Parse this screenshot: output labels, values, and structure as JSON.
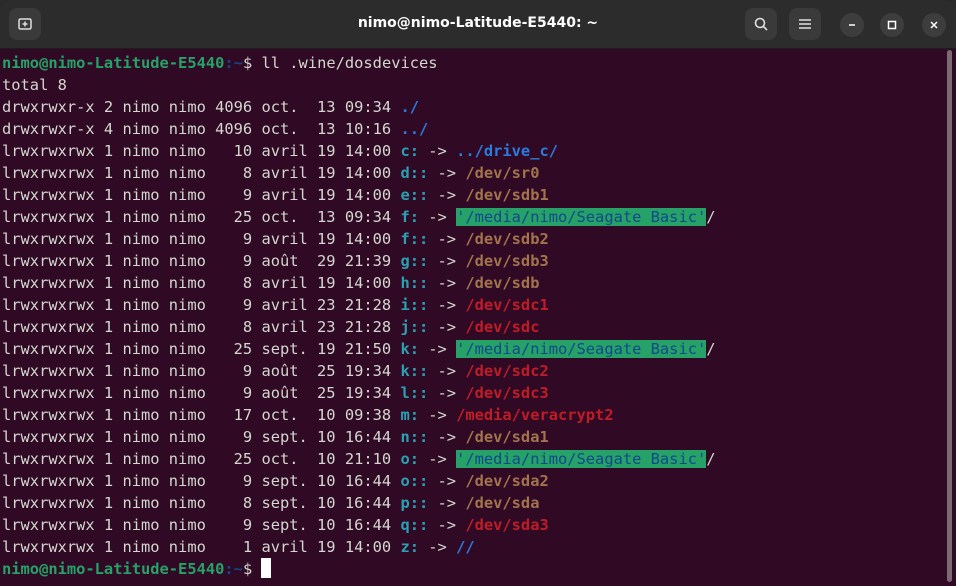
{
  "window": {
    "title": "nimo@nimo-Latitude-E5440: ~"
  },
  "titlebar": {
    "new_tab_icon": "new-tab-icon",
    "search_icon": "search-icon",
    "menu_icon": "hamburger-menu-icon"
  },
  "colors": {
    "background": "#300a24",
    "prompt_user": "#26a269",
    "prompt_path": "#12488b",
    "link": "#2aa1b3",
    "directory": "#2a7bde",
    "highlight": "#26a269"
  },
  "terminal": {
    "prompt_user": "nimo@nimo-Latitude-E5440",
    "prompt_path": ":~",
    "prompt_symbol": "$ ",
    "command": "ll .wine/dosdevices",
    "total": "total 8",
    "rows": [
      {
        "perms": "drwxrwxr-x",
        "links": "2",
        "owner": "nimo",
        "group": "nimo",
        "size": "4096",
        "month": "oct.",
        "day": "13",
        "time": "09:34",
        "name": "./",
        "arrow": "",
        "target": ""
      },
      {
        "perms": "drwxrwxr-x",
        "links": "4",
        "owner": "nimo",
        "group": "nimo",
        "size": "4096",
        "month": "oct.",
        "day": "13",
        "time": "10:16",
        "name": "../",
        "arrow": "",
        "target": ""
      },
      {
        "perms": "lrwxrwxrwx",
        "links": "1",
        "owner": "nimo",
        "group": "nimo",
        "size": "10",
        "month": "avril",
        "day": "19",
        "time": "14:00",
        "name": "c:",
        "arrow": " -> ",
        "target": "../drive_c/"
      },
      {
        "perms": "lrwxrwxrwx",
        "links": "1",
        "owner": "nimo",
        "group": "nimo",
        "size": "8",
        "month": "avril",
        "day": "19",
        "time": "14:00",
        "name": "d::",
        "arrow": " -> ",
        "target": "/dev/sr0"
      },
      {
        "perms": "lrwxrwxrwx",
        "links": "1",
        "owner": "nimo",
        "group": "nimo",
        "size": "9",
        "month": "avril",
        "day": "19",
        "time": "14:00",
        "name": "e::",
        "arrow": " -> ",
        "target": "/dev/sdb1"
      },
      {
        "perms": "lrwxrwxrwx",
        "links": "1",
        "owner": "nimo",
        "group": "nimo",
        "size": "25",
        "month": "oct.",
        "day": "13",
        "time": "09:34",
        "name": "f:",
        "arrow": " -> ",
        "target": "'/media/nimo/Seagate Basic'/"
      },
      {
        "perms": "lrwxrwxrwx",
        "links": "1",
        "owner": "nimo",
        "group": "nimo",
        "size": "9",
        "month": "avril",
        "day": "19",
        "time": "14:00",
        "name": "f::",
        "arrow": " -> ",
        "target": "/dev/sdb2"
      },
      {
        "perms": "lrwxrwxrwx",
        "links": "1",
        "owner": "nimo",
        "group": "nimo",
        "size": "9",
        "month": "août",
        "day": "29",
        "time": "21:39",
        "name": "g::",
        "arrow": " -> ",
        "target": "/dev/sdb3"
      },
      {
        "perms": "lrwxrwxrwx",
        "links": "1",
        "owner": "nimo",
        "group": "nimo",
        "size": "8",
        "month": "avril",
        "day": "19",
        "time": "14:00",
        "name": "h::",
        "arrow": " -> ",
        "target": "/dev/sdb"
      },
      {
        "perms": "lrwxrwxrwx",
        "links": "1",
        "owner": "nimo",
        "group": "nimo",
        "size": "9",
        "month": "avril",
        "day": "23",
        "time": "21:28",
        "name": "i::",
        "arrow": " -> ",
        "target": "/dev/sdc1"
      },
      {
        "perms": "lrwxrwxrwx",
        "links": "1",
        "owner": "nimo",
        "group": "nimo",
        "size": "8",
        "month": "avril",
        "day": "23",
        "time": "21:28",
        "name": "j::",
        "arrow": " -> ",
        "target": "/dev/sdc"
      },
      {
        "perms": "lrwxrwxrwx",
        "links": "1",
        "owner": "nimo",
        "group": "nimo",
        "size": "25",
        "month": "sept.",
        "day": "19",
        "time": "21:50",
        "name": "k:",
        "arrow": " -> ",
        "target": "'/media/nimo/Seagate Basic'/"
      },
      {
        "perms": "lrwxrwxrwx",
        "links": "1",
        "owner": "nimo",
        "group": "nimo",
        "size": "9",
        "month": "août",
        "day": "25",
        "time": "19:34",
        "name": "k::",
        "arrow": " -> ",
        "target": "/dev/sdc2"
      },
      {
        "perms": "lrwxrwxrwx",
        "links": "1",
        "owner": "nimo",
        "group": "nimo",
        "size": "9",
        "month": "août",
        "day": "25",
        "time": "19:34",
        "name": "l::",
        "arrow": " -> ",
        "target": "/dev/sdc3"
      },
      {
        "perms": "lrwxrwxrwx",
        "links": "1",
        "owner": "nimo",
        "group": "nimo",
        "size": "17",
        "month": "oct.",
        "day": "10",
        "time": "09:38",
        "name": "m:",
        "arrow": " -> ",
        "target": "/media/veracrypt2"
      },
      {
        "perms": "lrwxrwxrwx",
        "links": "1",
        "owner": "nimo",
        "group": "nimo",
        "size": "9",
        "month": "sept.",
        "day": "10",
        "time": "16:44",
        "name": "n::",
        "arrow": " -> ",
        "target": "/dev/sda1"
      },
      {
        "perms": "lrwxrwxrwx",
        "links": "1",
        "owner": "nimo",
        "group": "nimo",
        "size": "25",
        "month": "oct.",
        "day": "10",
        "time": "21:10",
        "name": "o:",
        "arrow": " -> ",
        "target": "'/media/nimo/Seagate Basic'/"
      },
      {
        "perms": "lrwxrwxrwx",
        "links": "1",
        "owner": "nimo",
        "group": "nimo",
        "size": "9",
        "month": "sept.",
        "day": "10",
        "time": "16:44",
        "name": "o::",
        "arrow": " -> ",
        "target": "/dev/sda2"
      },
      {
        "perms": "lrwxrwxrwx",
        "links": "1",
        "owner": "nimo",
        "group": "nimo",
        "size": "8",
        "month": "sept.",
        "day": "10",
        "time": "16:44",
        "name": "p::",
        "arrow": " -> ",
        "target": "/dev/sda"
      },
      {
        "perms": "lrwxrwxrwx",
        "links": "1",
        "owner": "nimo",
        "group": "nimo",
        "size": "9",
        "month": "sept.",
        "day": "10",
        "time": "16:44",
        "name": "q::",
        "arrow": " -> ",
        "target": "/dev/sda3"
      },
      {
        "perms": "lrwxrwxrwx",
        "links": "1",
        "owner": "nimo",
        "group": "nimo",
        "size": "1",
        "month": "avril",
        "day": "19",
        "time": "14:00",
        "name": "z:",
        "arrow": " -> ",
        "target": "//"
      }
    ]
  }
}
